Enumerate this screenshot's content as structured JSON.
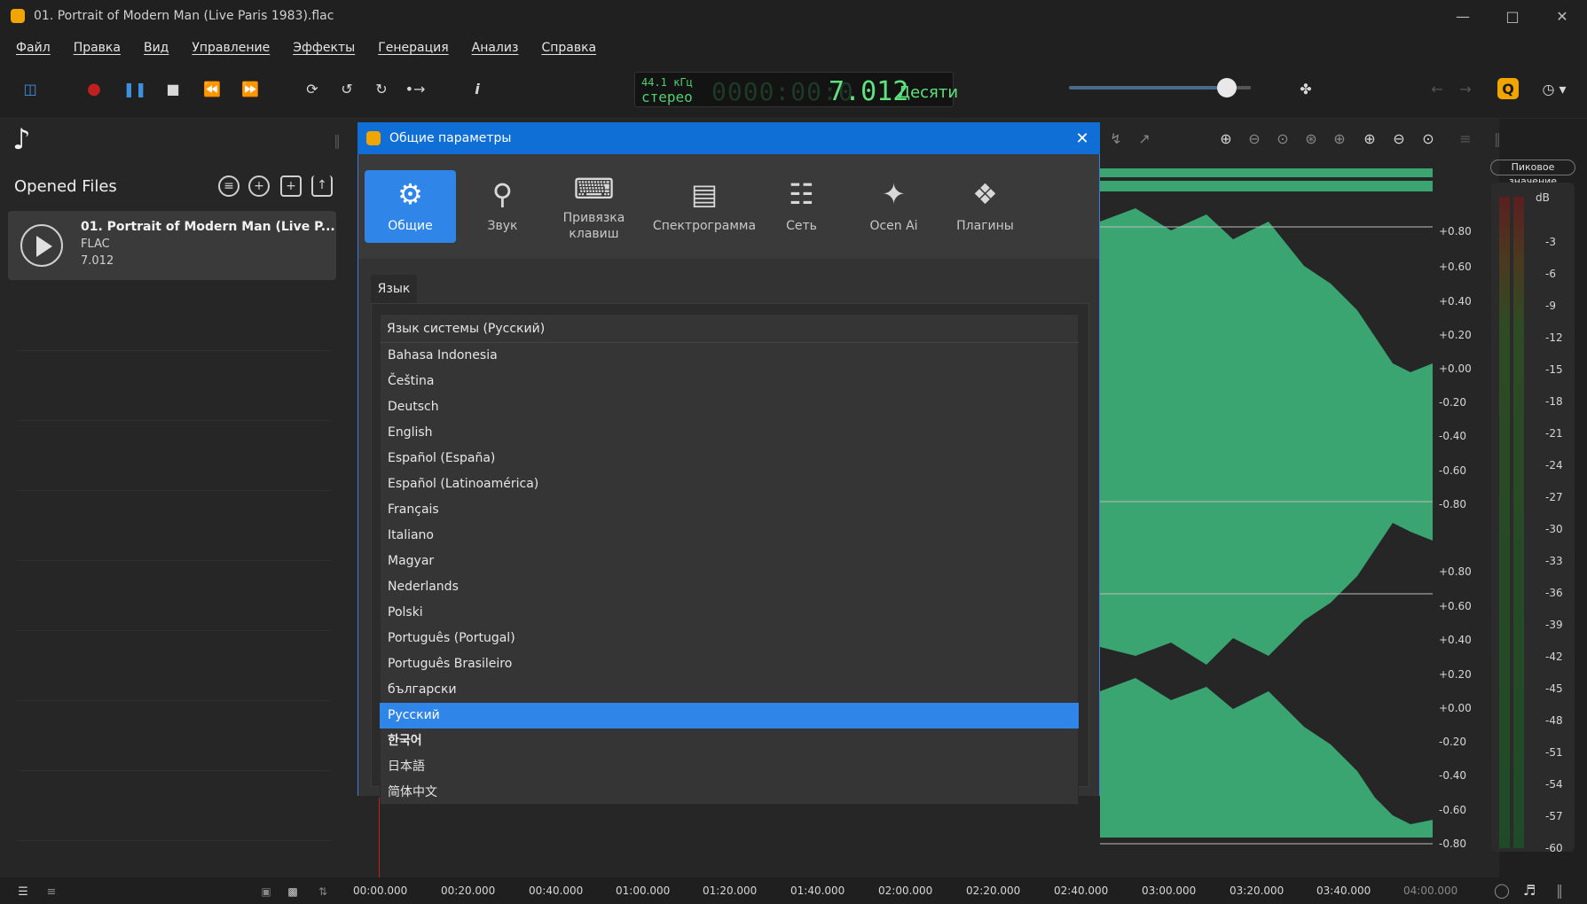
{
  "window": {
    "title": "01. Portrait of Modern Man (Live Paris 1983).flac",
    "controls": [
      "minimize-icon",
      "maximize-icon",
      "close-icon"
    ]
  },
  "menu": [
    "Файл",
    "Правка",
    "Вид",
    "Управление",
    "Эффекты",
    "Генерация",
    "Анализ",
    "Справка"
  ],
  "toolbar": {
    "lcd": {
      "rate": "44.1 кГц",
      "channels": "стерео",
      "ghost_digits": "0000:00:0",
      "time": "7.012",
      "unit": "Десяти"
    },
    "volume_fraction": 0.87,
    "accent_color": "#f0a500"
  },
  "left_panel": {
    "title": "Opened Files",
    "header_icons": [
      "filter-icon",
      "add-icon",
      "duplicate-icon",
      "export-icon"
    ],
    "files": [
      {
        "name": "01. Portrait of Modern Man (Live P...",
        "format": "FLAC",
        "duration": "7.012"
      }
    ]
  },
  "dialog": {
    "title": "Общие параметры",
    "tabs": [
      {
        "label": "Общие",
        "icon": "gear-icon",
        "active": true
      },
      {
        "label": "Звук",
        "icon": "planet-icon",
        "active": false
      },
      {
        "label": "Привязка клавиш",
        "icon": "keyboard-icon",
        "active": false
      },
      {
        "label": "Спектрограмма",
        "icon": "spectrum-icon",
        "active": false
      },
      {
        "label": "Сеть",
        "icon": "globe-icon",
        "active": false
      },
      {
        "label": "Ocen Ai",
        "icon": "sparkle-icon",
        "active": false
      },
      {
        "label": "Плагины",
        "icon": "puzzle-icon",
        "active": false
      }
    ],
    "section_label": "Язык",
    "language_dropdown": {
      "current": "Язык системы (Русский)",
      "options": [
        "Bahasa Indonesia",
        "Čeština",
        "Deutsch",
        "English",
        "Español (España)",
        "Español (Latinoamérica)",
        "Français",
        "Italiano",
        "Magyar",
        "Nederlands",
        "Polski",
        "Português (Portugal)",
        "Português Brasileiro",
        "български",
        "Русский",
        "한국어",
        "日本語",
        "简体中文"
      ],
      "selected": "Русский"
    }
  },
  "waveform": {
    "amplitude_ticks": [
      "+0.80",
      "+0.60",
      "+0.40",
      "+0.20",
      "+0.00",
      "-0.20",
      "-0.40",
      "-0.60",
      "-0.80"
    ],
    "meter_title": "Пиковое значение",
    "meter_unit": "dB",
    "db_ticks": [
      "-3",
      "-6",
      "-9",
      "-12",
      "-15",
      "-18",
      "-21",
      "-24",
      "-27",
      "-30",
      "-33",
      "-36",
      "-39",
      "-42",
      "-45",
      "-48",
      "-51",
      "-54",
      "-57",
      "-60"
    ],
    "time_ticks": [
      "00:00.000",
      "00:20.000",
      "00:40.000",
      "01:00.000",
      "01:20.000",
      "01:40.000",
      "02:00.000",
      "02:20.000",
      "02:40.000",
      "03:00.000",
      "03:20.000",
      "03:40.000",
      "04:00.000"
    ],
    "wave_color": "#3aa570"
  }
}
